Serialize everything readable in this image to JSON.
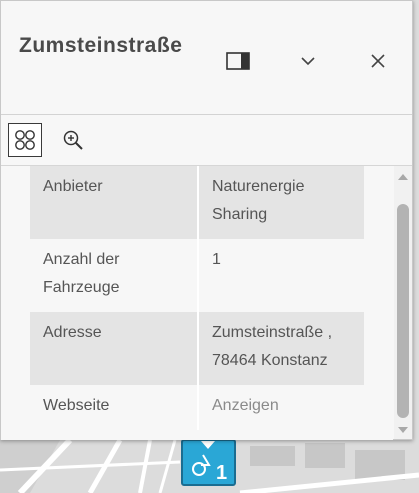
{
  "popup": {
    "title": "Zumsteinstraße",
    "attributes": [
      {
        "key": "Anbieter",
        "value": "Naturenergie Sharing"
      },
      {
        "key": "Anzahl der Fahrzeuge",
        "value": "1"
      },
      {
        "key": "Adresse",
        "value": "Zumsteinstraße , 78464 Konstanz"
      },
      {
        "key": "Webseite",
        "value": "Anzeigen"
      }
    ]
  },
  "icons": {
    "dock": "dock-panel-icon",
    "collapse": "chevron-down-icon",
    "close": "close-icon",
    "features": "feature-grid-icon",
    "zoom": "zoom-to-icon",
    "marker": "bike-sharing-station-icon"
  },
  "colors": {
    "marker_fill": "#2aa7d6",
    "text": "#555555",
    "link": "#8a8a8a"
  }
}
